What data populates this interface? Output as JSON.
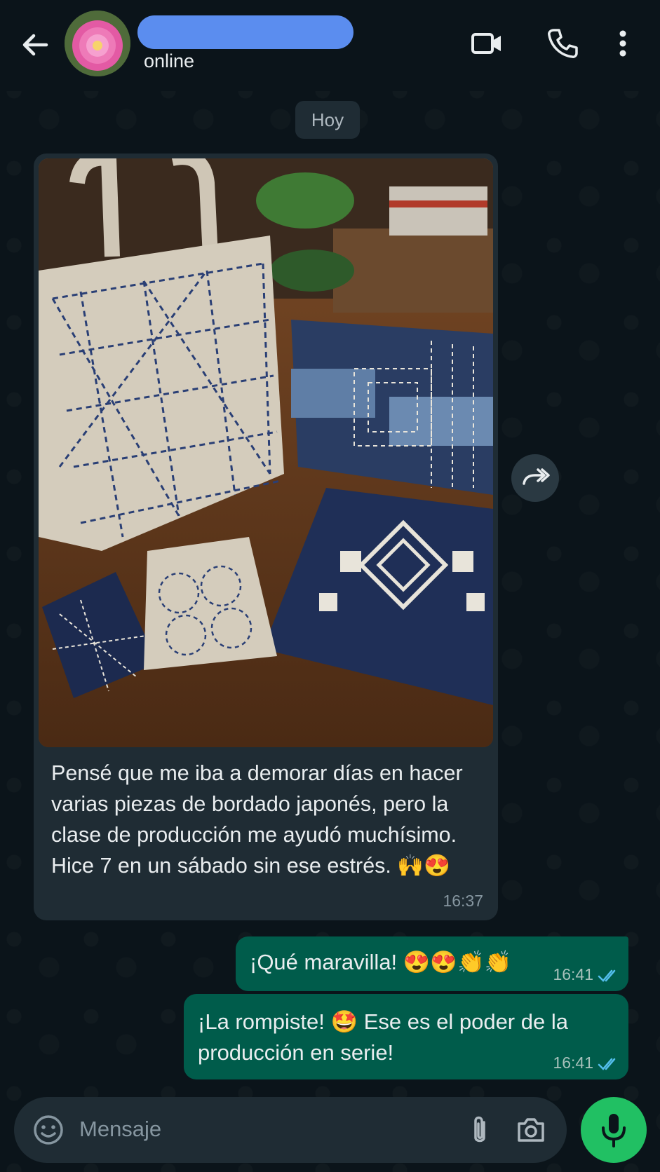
{
  "header": {
    "contact_status": "online",
    "icons": [
      "back-arrow-icon",
      "avatar",
      "video-call-icon",
      "phone-icon",
      "more-vert-icon"
    ]
  },
  "chat": {
    "date_label": "Hoy",
    "incoming": {
      "text": "Pensé que me iba a demorar días en hacer varias piezas de bordado japonés, pero la clase de producción me ayudó muchísimo. Hice 7 en un sábado sin ese estrés. 🙌😍",
      "time": "16:37"
    },
    "outgoing": [
      {
        "text": "¡Qué maravilla! 😍😍👏👏",
        "time": "16:41",
        "status": "read"
      },
      {
        "text": "¡La rompiste! 🤩 Ese es el poder de la producción en serie!",
        "time": "16:41",
        "status": "read"
      }
    ]
  },
  "composer": {
    "placeholder": "Mensaje",
    "icons": [
      "emoji-icon",
      "attach-icon",
      "camera-icon",
      "mic-icon"
    ]
  },
  "colors": {
    "background": "#0b141a",
    "incoming_bubble": "#1f2c34",
    "outgoing_bubble": "#005c4b",
    "accent": "#21c063",
    "read_ticks": "#53bdeb"
  }
}
